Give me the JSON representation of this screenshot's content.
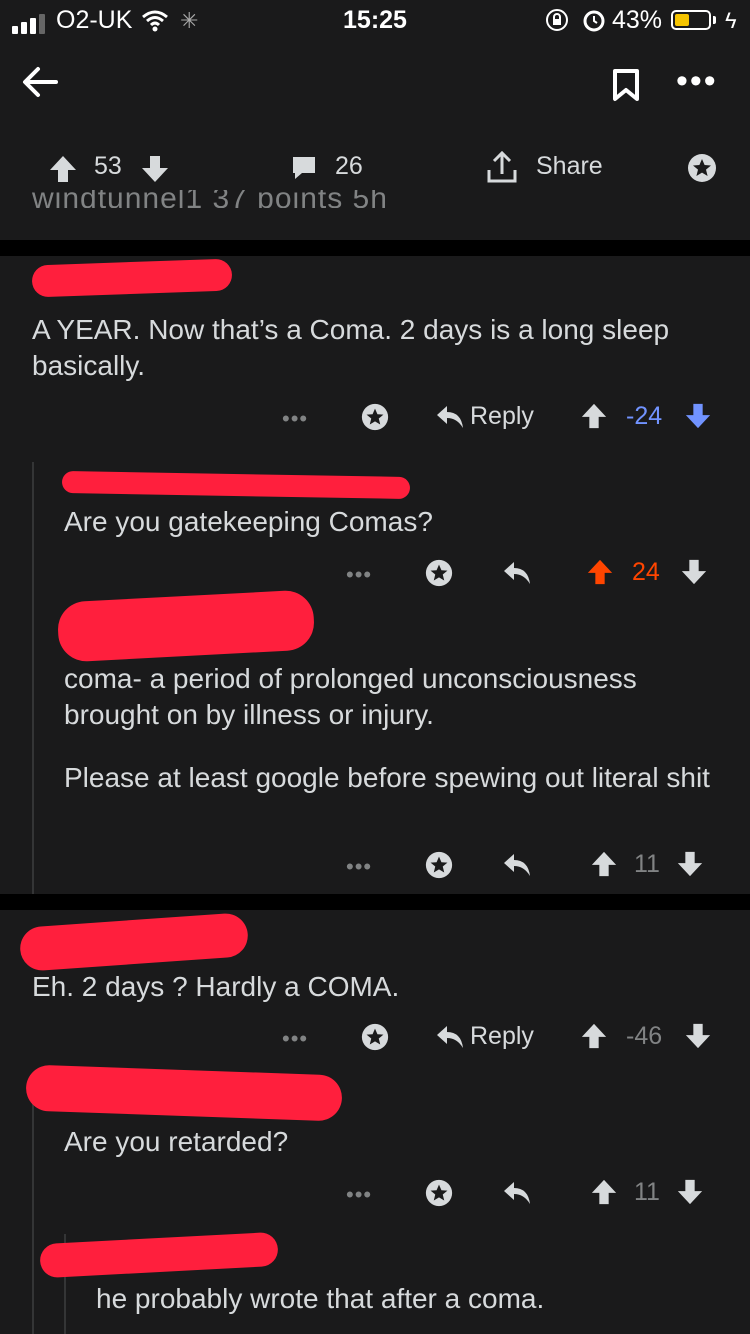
{
  "status": {
    "carrier": "O2-UK",
    "time": "15:25",
    "battery": "43%"
  },
  "post": {
    "upvotes": "53",
    "comments": "26",
    "share": "Share",
    "cut_text": "windtunnel1  37 points  5h"
  },
  "comments": [
    {
      "text": "A YEAR. Now that’s a Coma. 2 days is a long sleep basically.",
      "reply": "Reply",
      "score": "-24"
    },
    {
      "text": "Are you gatekeeping Comas?",
      "score": "24"
    },
    {
      "text1": "coma- a period of prolonged unconsciousness brought on by illness or injury.",
      "text2": "Please at least google before spewing out literal shit",
      "score": "11"
    },
    {
      "text": "Eh. 2 days ? Hardly a COMA.",
      "reply": "Reply",
      "score": "-46"
    },
    {
      "text": "Are you retarded?",
      "score": "11"
    },
    {
      "text": "he probably wrote that after a coma."
    }
  ],
  "colors": {
    "upvote": "#ff4500",
    "downvote": "#7193ff"
  }
}
